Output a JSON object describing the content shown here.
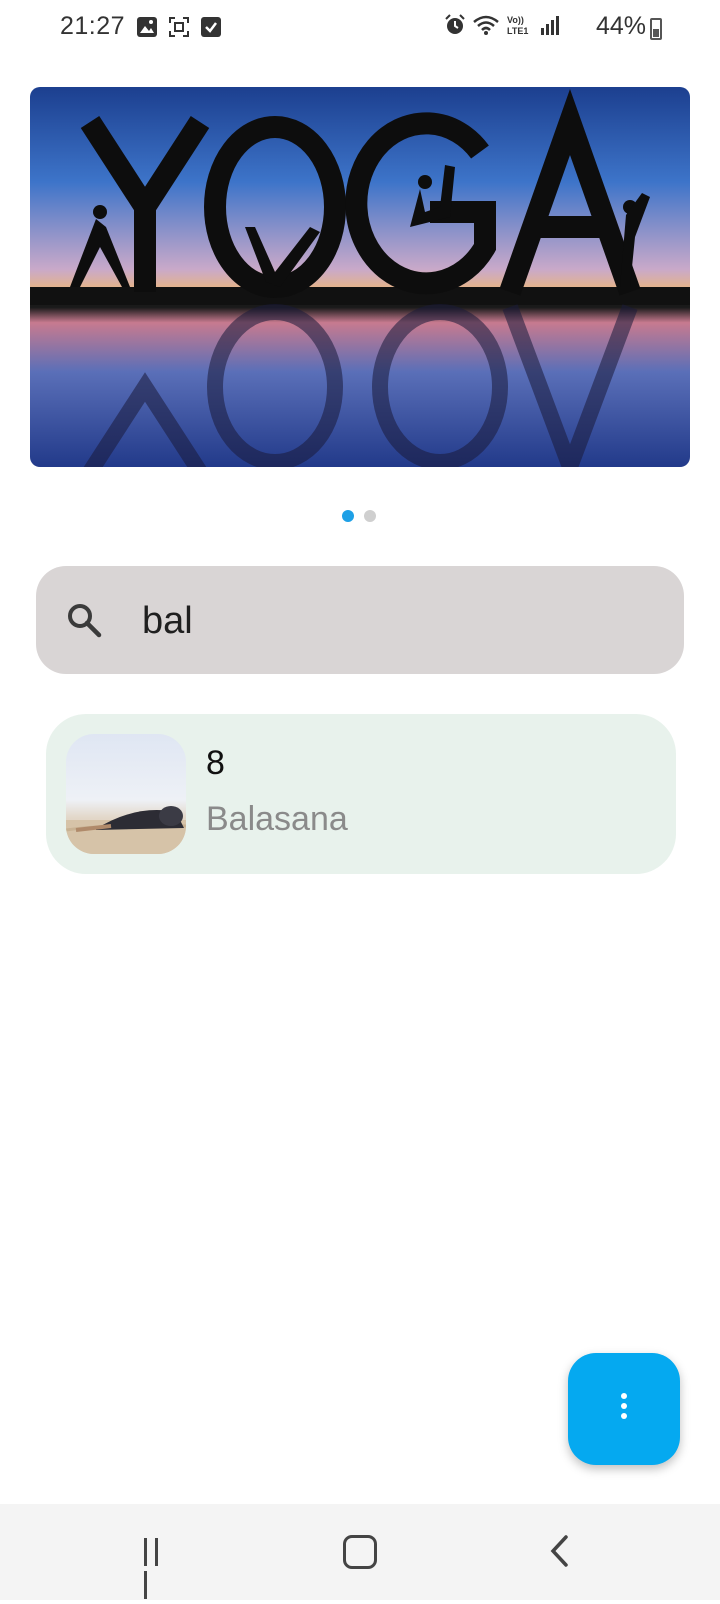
{
  "status_bar": {
    "time": "21:27",
    "battery": "44%",
    "left_icons": [
      "gallery-icon",
      "screenshot-icon",
      "task-icon"
    ],
    "right_icons": [
      "alarm-icon",
      "wifi-icon",
      "volte-icon",
      "signal-icon",
      "battery-icon"
    ]
  },
  "carousel": {
    "banner_text": "YOGA",
    "page_count": 2,
    "active_index": 0
  },
  "search": {
    "value": "bal",
    "icon": "search-icon"
  },
  "results": [
    {
      "number": "8",
      "name": "Balasana"
    }
  ],
  "fab": {
    "icon": "more-vertical-icon",
    "color": "#05a9f0"
  },
  "nav_bar": {
    "buttons": [
      "recent-apps",
      "home",
      "back"
    ]
  },
  "colors": {
    "search_bg": "#d9d5d5",
    "card_bg": "#e8f2ec",
    "dot_active": "#1ea0e6"
  }
}
